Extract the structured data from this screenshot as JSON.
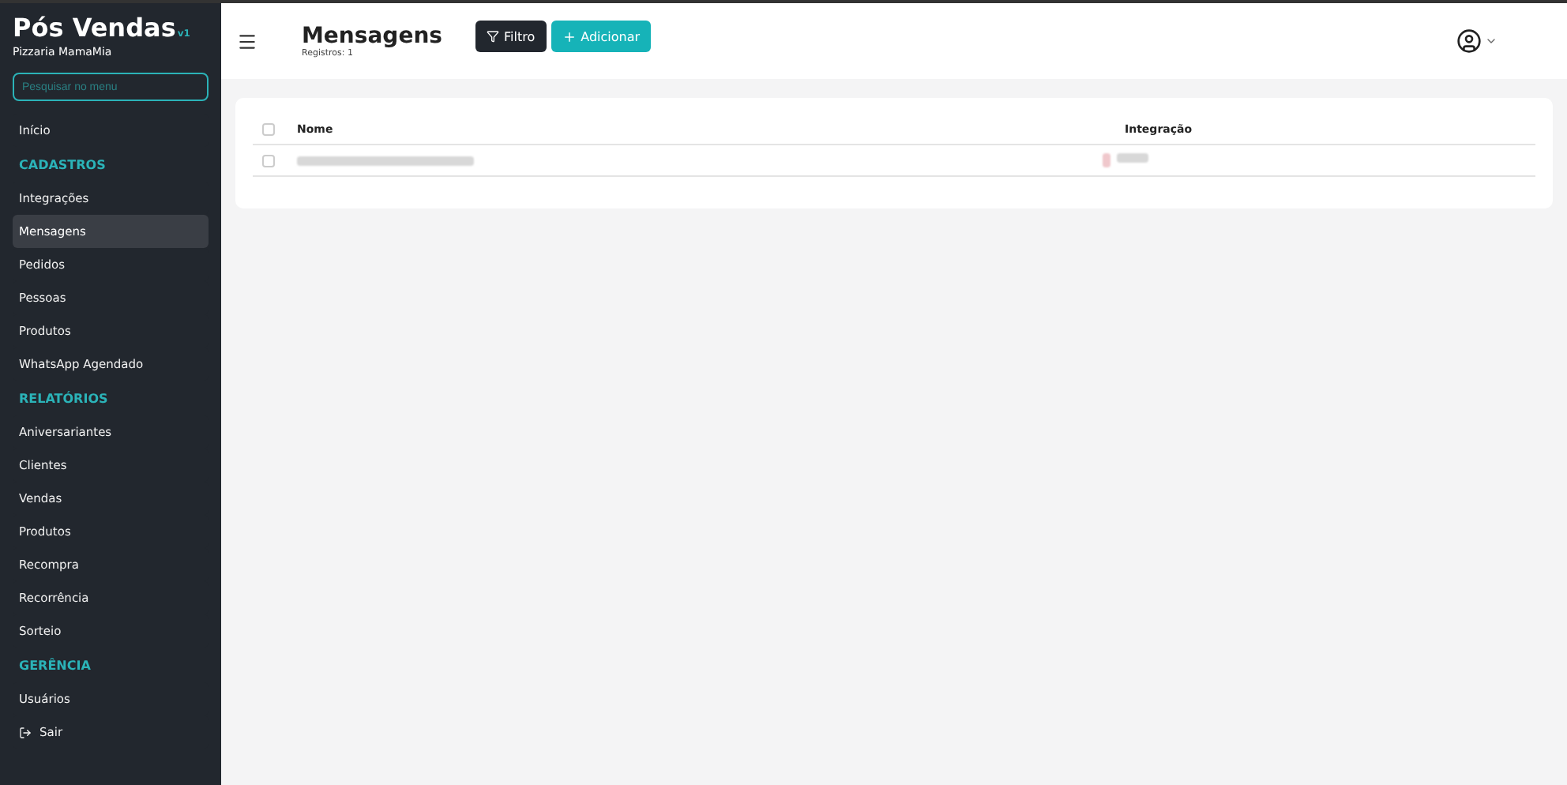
{
  "brand": {
    "title": "Pós Vendas",
    "version": "v1",
    "subtitle": "Pizzaria MamaMia"
  },
  "search": {
    "placeholder": "Pesquisar no menu"
  },
  "menu": [
    {
      "kind": "item",
      "label": "Início",
      "selected": false
    },
    {
      "kind": "header",
      "label": "CADASTROS"
    },
    {
      "kind": "item",
      "label": "Integrações",
      "selected": false
    },
    {
      "kind": "item",
      "label": "Mensagens",
      "selected": true
    },
    {
      "kind": "item",
      "label": "Pedidos",
      "selected": false
    },
    {
      "kind": "item",
      "label": "Pessoas",
      "selected": false
    },
    {
      "kind": "item",
      "label": "Produtos",
      "selected": false
    },
    {
      "kind": "item",
      "label": "WhatsApp Agendado",
      "selected": false
    },
    {
      "kind": "header",
      "label": "RELATÓRIOS"
    },
    {
      "kind": "item",
      "label": "Aniversariantes",
      "selected": false
    },
    {
      "kind": "item",
      "label": "Clientes",
      "selected": false
    },
    {
      "kind": "item",
      "label": "Vendas",
      "selected": false
    },
    {
      "kind": "item",
      "label": "Produtos",
      "selected": false
    },
    {
      "kind": "item",
      "label": "Recompra",
      "selected": false
    },
    {
      "kind": "item",
      "label": "Recorrência",
      "selected": false
    },
    {
      "kind": "item",
      "label": "Sorteio",
      "selected": false
    },
    {
      "kind": "header",
      "label": "GERÊNCIA"
    },
    {
      "kind": "item",
      "label": "Usuários",
      "selected": false
    },
    {
      "kind": "logout",
      "label": "Sair",
      "selected": false
    }
  ],
  "page": {
    "title": "Mensagens",
    "count": "Registros: 1",
    "buttons": [
      {
        "kind": "filter",
        "label": "Filtro"
      },
      {
        "kind": "add",
        "label": "Adicionar"
      }
    ]
  },
  "table": {
    "columns": [
      "Nome",
      "Integração"
    ],
    "header_checked": false,
    "rows": [
      {
        "checked": false
      }
    ]
  }
}
